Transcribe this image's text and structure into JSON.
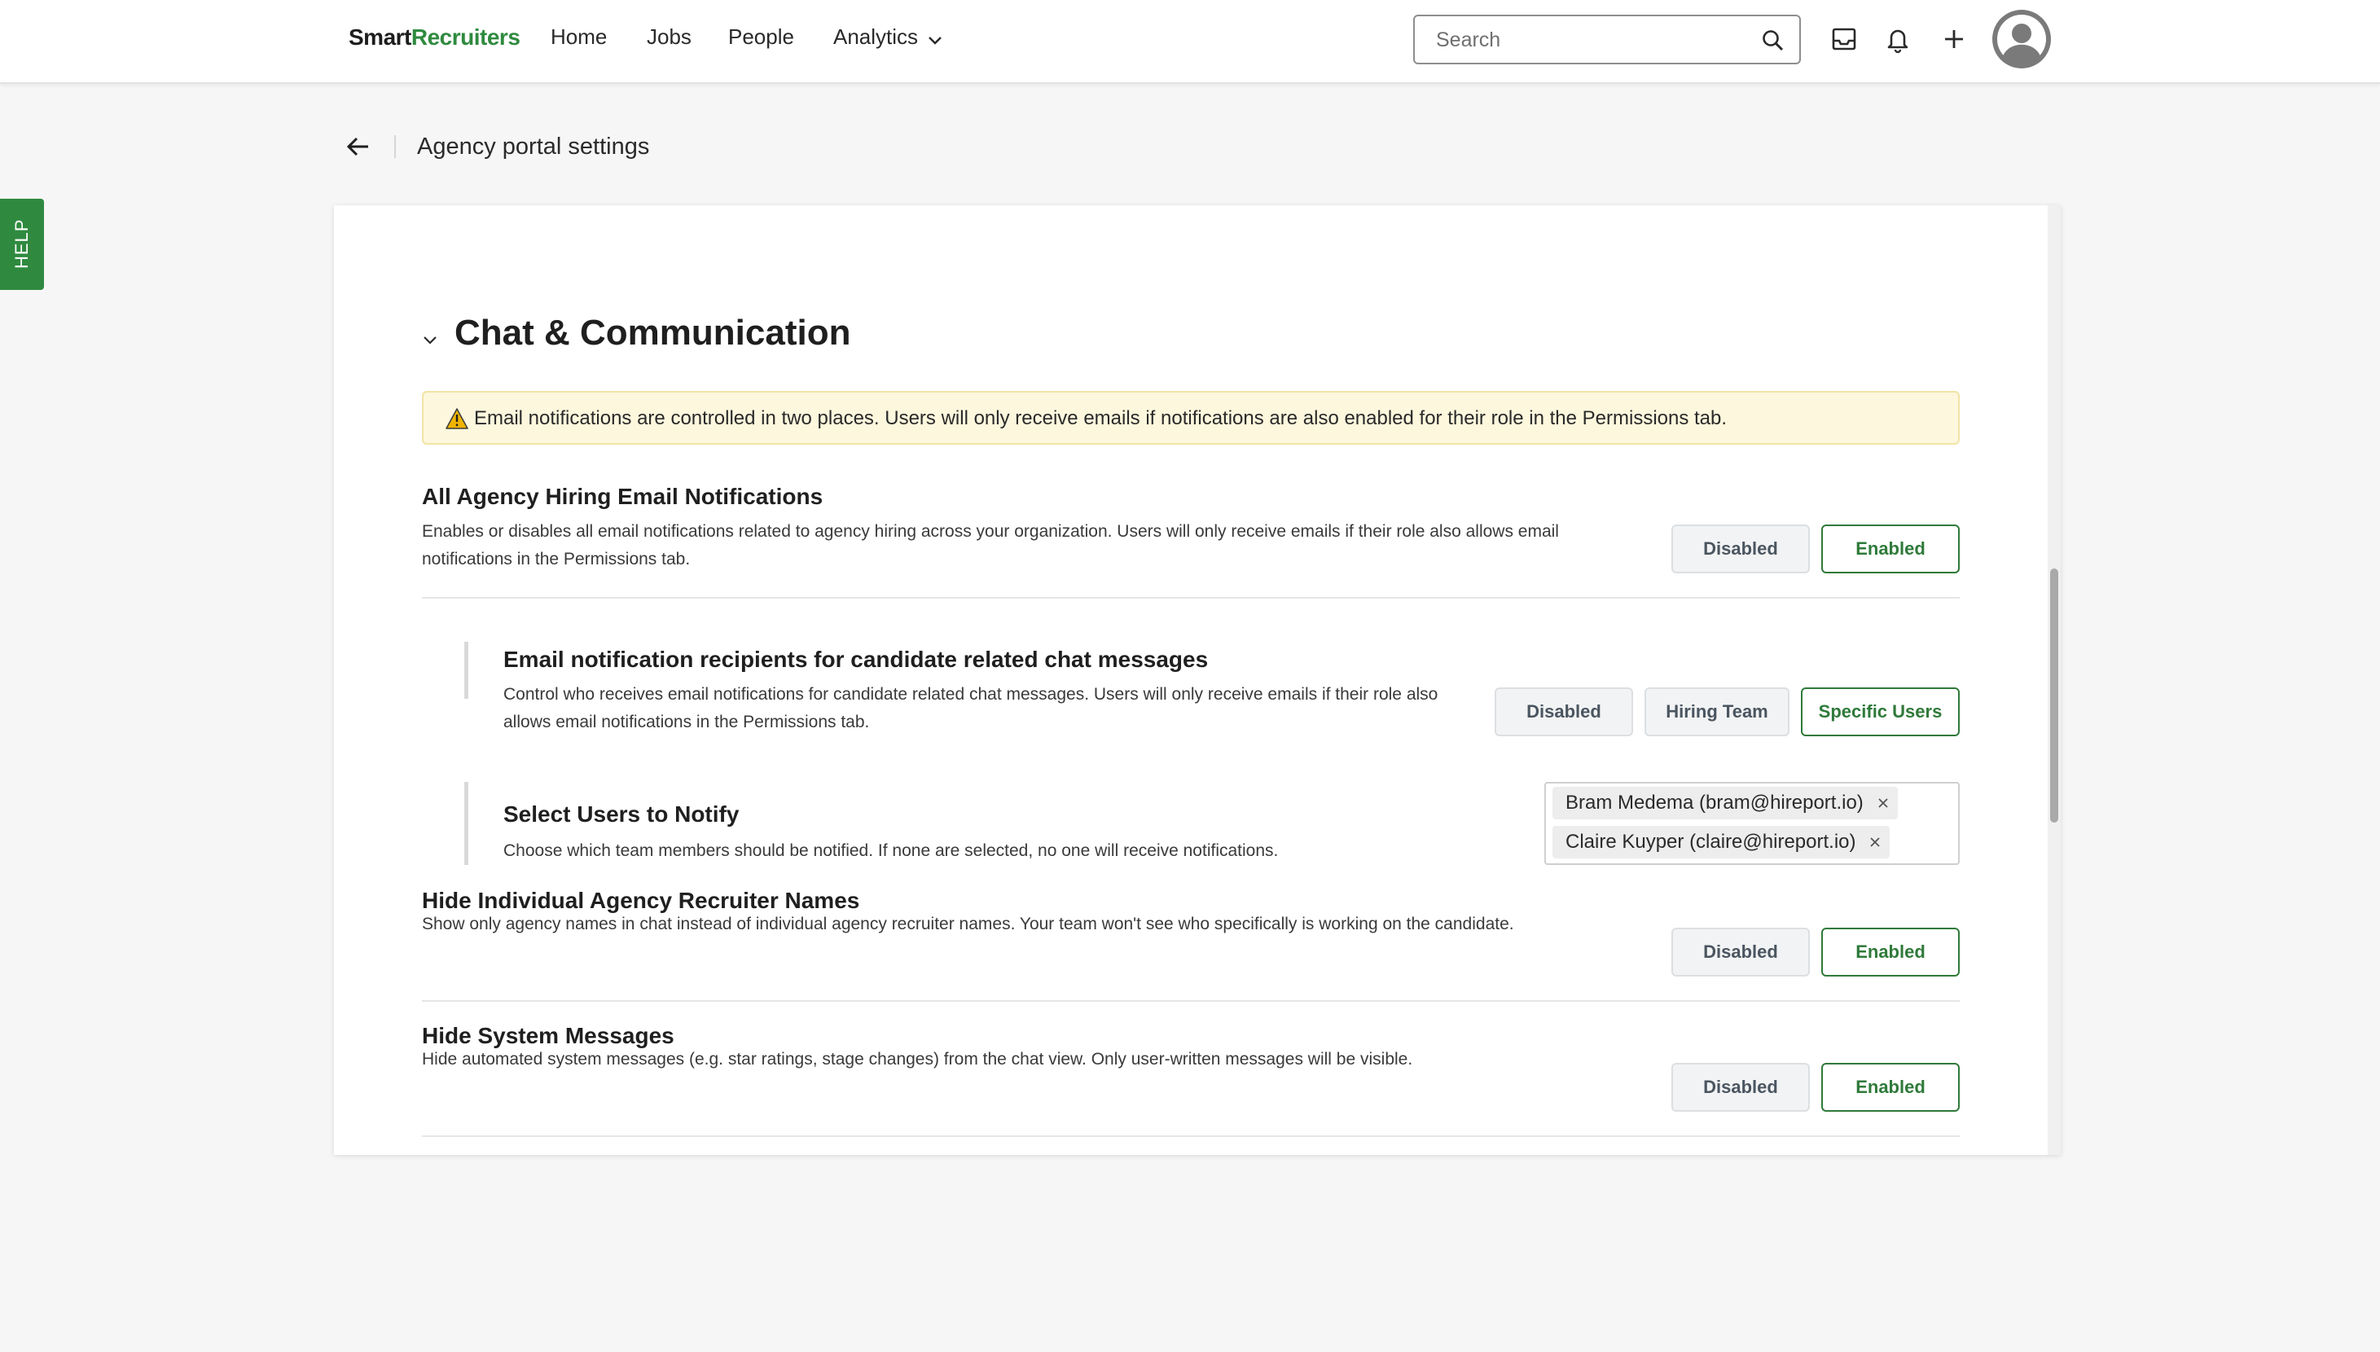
{
  "nav": {
    "logo_part1": "Smart",
    "logo_part2": "Recruiters",
    "home": "Home",
    "jobs": "Jobs",
    "people": "People",
    "analytics": "Analytics",
    "search_placeholder": "Search"
  },
  "help_tab": {
    "label": "HELP"
  },
  "header": {
    "title": "Agency portal settings"
  },
  "section": {
    "title": "Chat & Communication",
    "warning": "Email notifications are controlled in two places. Users will only receive emails if notifications are also enabled for their role in the Permissions tab."
  },
  "settings": [
    {
      "title": "All Agency Hiring Email Notifications",
      "description": "Enables or disables all email notifications related to agency hiring across your organization. Users will only receive emails if their role also allows email notifications in the Permissions tab.",
      "options": [
        "Disabled",
        "Enabled"
      ],
      "selected": "Enabled"
    },
    {
      "title": "Email notification recipients for candidate related chat messages",
      "description": "Control who receives email notifications for candidate related chat messages. Users will only receive emails if their role also allows email notifications in the Permissions tab.",
      "options": [
        "Disabled",
        "Hiring Team",
        "Specific Users"
      ],
      "selected": "Specific Users"
    },
    {
      "title": "Select Users to Notify",
      "description": "Choose which team members should be notified. If none are selected, no one will receive notifications.",
      "selected_users": [
        "Bram Medema (bram@hireport.io)",
        "Claire Kuyper (claire@hireport.io)"
      ]
    },
    {
      "title": "Hide Individual Agency Recruiter Names",
      "description": "Show only agency names in chat instead of individual agency recruiter names. Your team won't see who specifically is working on the candidate.",
      "options": [
        "Disabled",
        "Enabled"
      ],
      "selected": "Enabled"
    },
    {
      "title": "Hide System Messages",
      "description": "Hide automated system messages (e.g. star ratings, stage changes) from the chat view. Only user-written messages will be visible.",
      "options": [
        "Disabled",
        "Enabled"
      ],
      "selected": "Enabled"
    }
  ],
  "colors": {
    "brand_green": "#2f8a3f",
    "enabled_border": "#2f7a3a",
    "warning_bg": "#fdf7dd"
  }
}
